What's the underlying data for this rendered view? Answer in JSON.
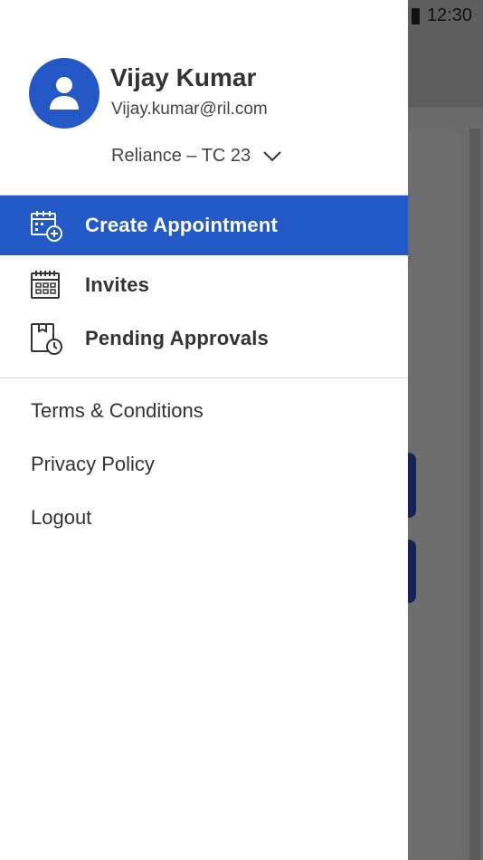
{
  "status_bar": {
    "time": "12:30"
  },
  "profile": {
    "name": "Vijay Kumar",
    "email": "Vijay.kumar@ril.com",
    "organization": "Reliance – TC 23"
  },
  "menu": [
    {
      "label": "Create Appointment",
      "icon": "calendar-add-icon",
      "active": true
    },
    {
      "label": "Invites",
      "icon": "calendar-grid-icon",
      "active": false
    },
    {
      "label": "Pending Approvals",
      "icon": "document-clock-icon",
      "active": false
    }
  ],
  "links": [
    {
      "label": "Terms & Conditions"
    },
    {
      "label": "Privacy Policy"
    },
    {
      "label": "Logout"
    }
  ],
  "colors": {
    "accent": "#2358c7",
    "avatar": "#2458c6",
    "text": "#333333"
  }
}
